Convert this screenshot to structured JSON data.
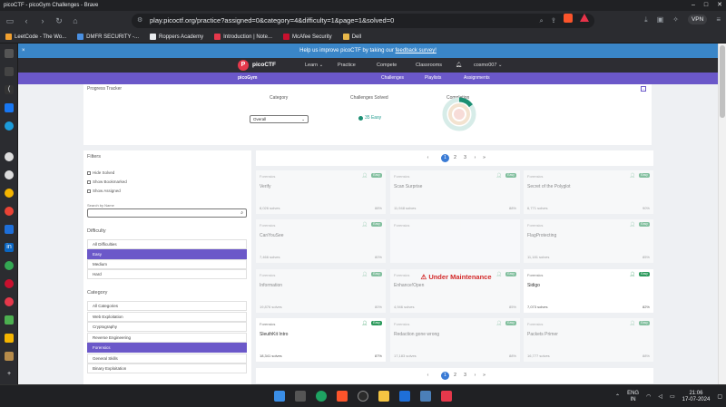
{
  "window": {
    "title": "picoCTF - picoGym Challenges - Brave"
  },
  "browser": {
    "url": "play.picoctf.org/practice?assigned=0&category=4&difficulty=1&page=1&solved=0",
    "vpn_label": "VPN",
    "bookmarks": [
      {
        "label": "LeetCode - The Wo...",
        "color": "#f0a030"
      },
      {
        "label": "DMFR SECURITY -...",
        "color": "#4a90e2"
      },
      {
        "label": "Roppers Academy",
        "color": "#e8eaed"
      },
      {
        "label": "Introduction | Note...",
        "color": "#e5384b"
      },
      {
        "label": "McAfee Security",
        "color": "#c8102e"
      },
      {
        "label": "Dell",
        "color": "#e8b84a"
      }
    ]
  },
  "site": {
    "banner": {
      "text": "Help us improve picoCTF by taking our",
      "link": "feedback survey!"
    },
    "logo_letter": "P",
    "logo_text": "picoCTF",
    "nav": [
      {
        "label": "Learn",
        "chevron": "⌄"
      },
      {
        "label": "Practice",
        "chevron": ""
      },
      {
        "label": "Compete",
        "chevron": ""
      },
      {
        "label": "Classrooms",
        "chevron": ""
      }
    ],
    "user": {
      "name": "cosmo007",
      "chevron": "⌄"
    },
    "subnav": {
      "brand": "picoGym",
      "items": [
        "Challenges",
        "Playlists",
        "Assignments"
      ]
    }
  },
  "progress": {
    "title": "Progress Tracker",
    "col_category": "Category",
    "col_solved": "Challenges Solved",
    "col_completion": "Completion",
    "category_value": "Overall",
    "solved_value": "35 Easy",
    "completion_fraction": 0.15
  },
  "filters": {
    "title": "Filters",
    "checkboxes": [
      "Hide Solved",
      "Show Bookmarked",
      "Show Assigned"
    ],
    "search_label": "Search by Name",
    "difficulty_label": "Difficulty",
    "difficulty": [
      {
        "label": "All Difficulties",
        "selected": false
      },
      {
        "label": "Easy",
        "selected": true
      },
      {
        "label": "Medium",
        "selected": false
      },
      {
        "label": "Hard",
        "selected": false
      }
    ],
    "category_label": "Category",
    "categories": [
      {
        "label": "All Categories",
        "selected": false
      },
      {
        "label": "Web Exploitation",
        "selected": false
      },
      {
        "label": "Cryptography",
        "selected": false
      },
      {
        "label": "Reverse Engineering",
        "selected": false
      },
      {
        "label": "Forensics",
        "selected": true
      },
      {
        "label": "General Skills",
        "selected": false
      },
      {
        "label": "Binary Exploitation",
        "selected": false
      }
    ]
  },
  "pagination": {
    "prev": "‹",
    "next": "›",
    "first": "«",
    "last": "»",
    "pages": [
      "1",
      "2",
      "3"
    ],
    "current": "1"
  },
  "challenges": [
    {
      "category": "Forensics",
      "name": "Verify",
      "solves": "8,026 solves",
      "rate": "88%",
      "badge": "Easy",
      "dim": true
    },
    {
      "category": "Forensics",
      "name": "Scan Surprise",
      "solves": "11,948 solves",
      "rate": "88%",
      "badge": "Easy",
      "dim": true
    },
    {
      "category": "Forensics",
      "name": "Secret of the Polyglot",
      "solves": "6,771 solves",
      "rate": "90%",
      "badge": "Easy",
      "dim": true
    },
    {
      "category": "Forensics",
      "name": "CanYouSee",
      "solves": "7,466 solves",
      "rate": "80%",
      "badge": "Easy",
      "dim": true
    },
    {
      "category": "Forensics",
      "name": "",
      "solves": "",
      "rate": "",
      "badge": "",
      "dim": true,
      "maintenance": "Under Maintenance"
    },
    {
      "category": "Forensics",
      "name": "FlagProtecting",
      "solves": "11,181 solves",
      "rate": "85%",
      "badge": "Easy",
      "dim": true
    },
    {
      "category": "Forensics",
      "name": "Information",
      "solves": "19,876 solves",
      "rate": "80%",
      "badge": "Easy",
      "dim": true
    },
    {
      "category": "Forensics",
      "name": "Enhance!Open",
      "solves": "4,946 solves",
      "rate": "85%",
      "badge": "Easy",
      "dim": true
    },
    {
      "category": "Forensics",
      "name": "Sidigo",
      "solves": "7,073 solves",
      "rate": "82%",
      "badge": "Easy",
      "dim": false
    },
    {
      "category": "Forensics",
      "name": "SleuthKit Intro",
      "solves": "18,341 solves",
      "rate": "87%",
      "badge": "Easy",
      "dim": false
    },
    {
      "category": "Forensics",
      "name": "Redaction gone wrong",
      "solves": "17,183 solves",
      "rate": "88%",
      "badge": "Easy",
      "dim": true
    },
    {
      "category": "Forensics",
      "name": "Packets Primer",
      "solves": "16,777 solves",
      "rate": "88%",
      "badge": "Easy",
      "dim": true
    }
  ],
  "taskbar": {
    "lang": "ENG",
    "region": "IN",
    "time": "21:06",
    "date": "17-07-2024"
  }
}
